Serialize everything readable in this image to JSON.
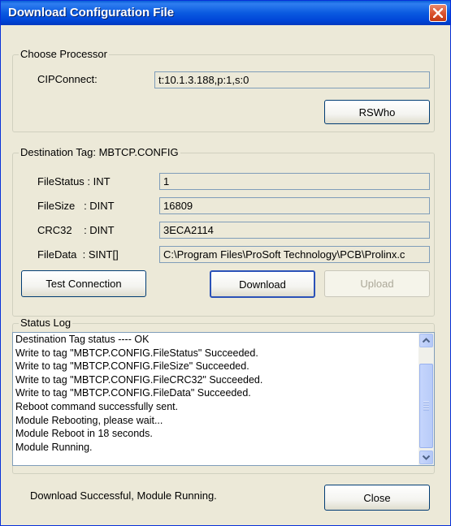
{
  "window": {
    "title": "Download Configuration File"
  },
  "processor": {
    "legend": "Choose Processor",
    "cipconnect_label": "CIPConnect:",
    "cipconnect_value": "t:10.1.3.188,p:1,s:0",
    "rswho_label": "RSWho"
  },
  "destination": {
    "legend": "Destination Tag: MBTCP.CONFIG",
    "fields": [
      {
        "label": "FileStatus : INT",
        "value": "1"
      },
      {
        "label": "FileSize   : DINT",
        "value": "16809"
      },
      {
        "label": "CRC32    : DINT",
        "value": "3ECA2114"
      },
      {
        "label": "FileData  : SINT[]",
        "value": "C:\\Program Files\\ProSoft Technology\\PCB\\Prolinx.c"
      }
    ],
    "test_connection_label": "Test Connection",
    "download_label": "Download",
    "upload_label": "Upload"
  },
  "status_log": {
    "legend": "Status Log",
    "lines": [
      "Destination Tag status ---- OK",
      "Write to tag \"MBTCP.CONFIG.FileStatus\" Succeeded.",
      "Write to tag \"MBTCP.CONFIG.FileSize\" Succeeded.",
      "Write to tag \"MBTCP.CONFIG.FileCRC32\" Succeeded.",
      "Write to tag \"MBTCP.CONFIG.FileData\" Succeeded.",
      "Reboot command successfully sent.",
      "Module Rebooting, please wait...",
      "Module Reboot in 18 seconds.",
      "Module Running."
    ]
  },
  "footer": {
    "status_text": "Download Successful, Module Running.",
    "close_label": "Close"
  },
  "colors": {
    "title_bar": "#0a5ae0",
    "dialog_bg": "#ece9d8",
    "close_button": "#d9512c"
  },
  "icons": [
    "close-icon",
    "scroll-up-icon",
    "scroll-down-icon",
    "scroll-grip-icon"
  ]
}
